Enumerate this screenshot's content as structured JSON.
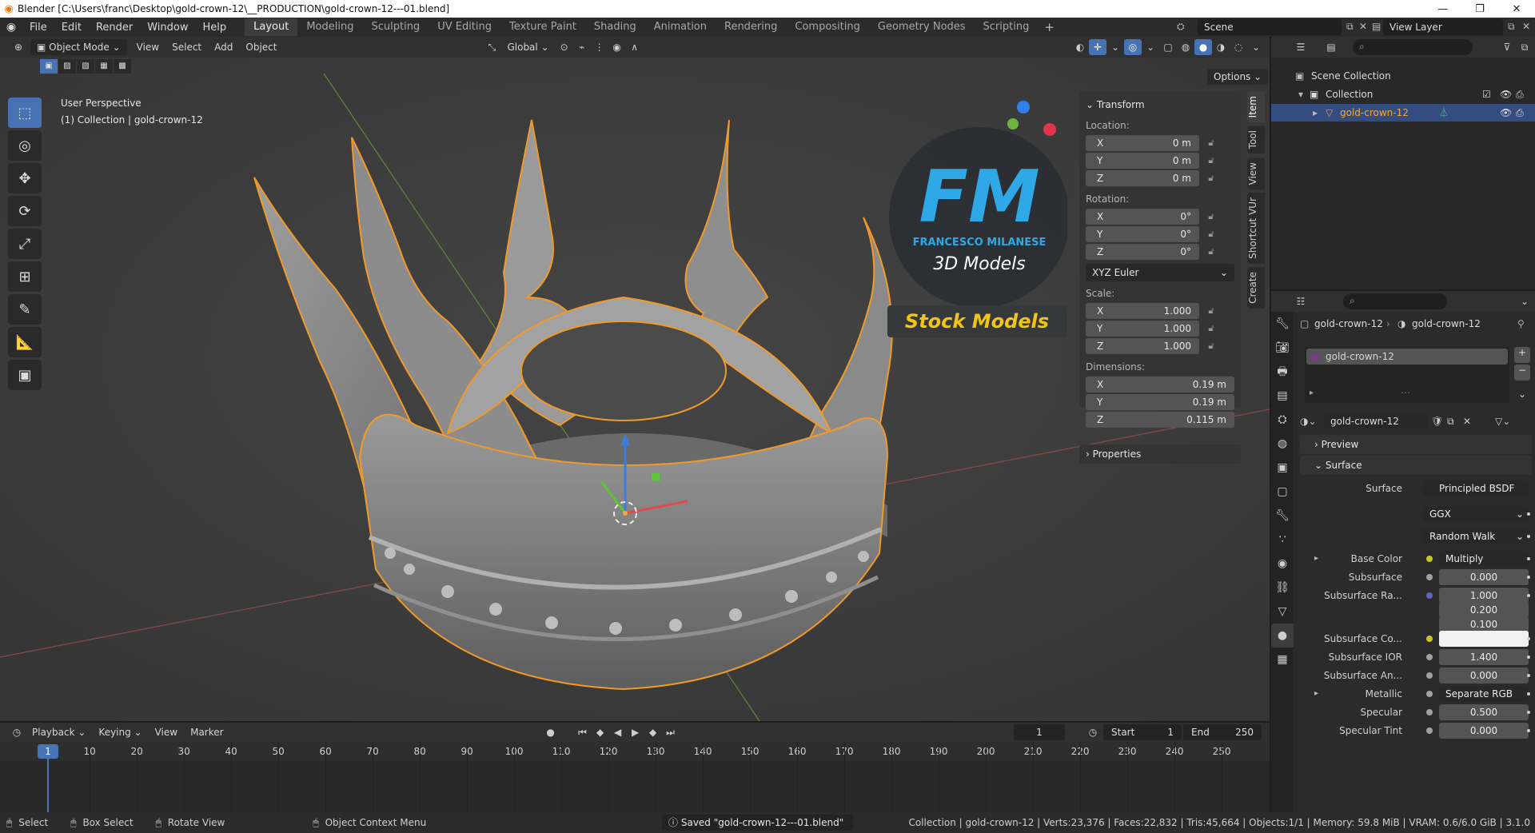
{
  "titlebar": {
    "title": "Blender [C:\\Users\\franc\\Desktop\\gold-crown-12\\__PRODUCTION\\gold-crown-12---01.blend]",
    "minimize": "—",
    "maximize": "❐",
    "close": "✕"
  },
  "menu": {
    "file": "File",
    "edit": "Edit",
    "render": "Render",
    "window": "Window",
    "help": "Help"
  },
  "workspaces": [
    "Layout",
    "Modeling",
    "Sculpting",
    "UV Editing",
    "Texture Paint",
    "Shading",
    "Animation",
    "Rendering",
    "Compositing",
    "Geometry Nodes",
    "Scripting"
  ],
  "scene": {
    "label": "Scene",
    "view_layer": "View Layer"
  },
  "viewport_header": {
    "mode": "Object Mode",
    "view": "View",
    "select": "Select",
    "add": "Add",
    "object": "Object",
    "orientation": "Global",
    "options": "Options"
  },
  "viewport": {
    "perspective": "User Perspective",
    "collection_info": "(1) Collection | gold-crown-12",
    "watermark_initials": "FM",
    "watermark_name": "FRANCESCO MILANESE",
    "watermark_sub": "3D Models",
    "watermark_banner": "Stock Models"
  },
  "npanel": {
    "transform": "Transform",
    "location_label": "Location:",
    "location": {
      "x": "0 m",
      "y": "0 m",
      "z": "0 m"
    },
    "rotation_label": "Rotation:",
    "rotation": {
      "x": "0°",
      "y": "0°",
      "z": "0°"
    },
    "rotation_mode": "XYZ Euler",
    "scale_label": "Scale:",
    "scale": {
      "x": "1.000",
      "y": "1.000",
      "z": "1.000"
    },
    "dimensions_label": "Dimensions:",
    "dimensions": {
      "x": "0.19 m",
      "y": "0.19 m",
      "z": "0.115 m"
    },
    "axis_x": "X",
    "axis_y": "Y",
    "axis_z": "Z",
    "properties": "Properties",
    "tabs": [
      "Item",
      "Tool",
      "View",
      "Shortcut VUr",
      "Create"
    ]
  },
  "timeline": {
    "playback": "Playback",
    "keying": "Keying",
    "view": "View",
    "marker": "Marker",
    "current_frame": "1",
    "start_label": "Start",
    "start": "1",
    "end_label": "End",
    "end": "250",
    "ruler": [
      "1",
      "10",
      "20",
      "30",
      "40",
      "50",
      "60",
      "70",
      "80",
      "90",
      "100",
      "110",
      "120",
      "130",
      "140",
      "150",
      "160",
      "170",
      "180",
      "190",
      "200",
      "210",
      "220",
      "230",
      "240",
      "250"
    ]
  },
  "statusbar": {
    "select": "Select",
    "box_select": "Box Select",
    "rotate_view": "Rotate View",
    "context_menu": "Object Context Menu",
    "saved": "Saved \"gold-crown-12---01.blend\"",
    "info": "Collection | gold-crown-12 | Verts:23,376 | Faces:22,832 | Tris:45,664 | Objects:1/1 | Memory: 59.8 MiB | VRAM: 0.6/6.0 GiB | 3.1.0"
  },
  "outliner": {
    "scene_collection": "Scene Collection",
    "collection": "Collection",
    "object": "gold-crown-12"
  },
  "properties": {
    "breadcrumb_object": "gold-crown-12",
    "breadcrumb_material": "gold-crown-12",
    "material_slot": "gold-crown-12",
    "material_name": "gold-crown-12",
    "preview": "Preview",
    "surface_panel": "Surface",
    "surface_label": "Surface",
    "surface_value": "Principled BSDF",
    "distribution": "GGX",
    "subsurface_method": "Random Walk",
    "rows": [
      {
        "label": "Base Color",
        "value": "Multiply",
        "dot": "#c7c729",
        "kind": "link"
      },
      {
        "label": "Subsurface",
        "value": "0.000",
        "dot": "#a1a1a1",
        "kind": "num"
      },
      {
        "label": "Subsurface Ra...",
        "value": "1.000",
        "dot": "#6363c7",
        "kind": "num"
      },
      {
        "label": "",
        "value": "0.200",
        "dot": "",
        "kind": "num"
      },
      {
        "label": "",
        "value": "0.100",
        "dot": "",
        "kind": "num"
      },
      {
        "label": "Subsurface Co...",
        "value": "",
        "dot": "#c7c729",
        "kind": "color"
      },
      {
        "label": "Subsurface IOR",
        "value": "1.400",
        "dot": "#a1a1a1",
        "kind": "num"
      },
      {
        "label": "Subsurface An...",
        "value": "0.000",
        "dot": "#a1a1a1",
        "kind": "num"
      },
      {
        "label": "Metallic",
        "value": "Separate RGB",
        "dot": "#a1a1a1",
        "kind": "link"
      },
      {
        "label": "Specular",
        "value": "0.500",
        "dot": "#a1a1a1",
        "kind": "num"
      },
      {
        "label": "Specular Tint",
        "value": "0.000",
        "dot": "#a1a1a1",
        "kind": "num"
      }
    ]
  },
  "colors": {
    "accent": "#4772b3",
    "selection_outline": "#f19a2a",
    "watermark_blue": "#2ea8e6",
    "watermark_banner": "#f2c416"
  }
}
